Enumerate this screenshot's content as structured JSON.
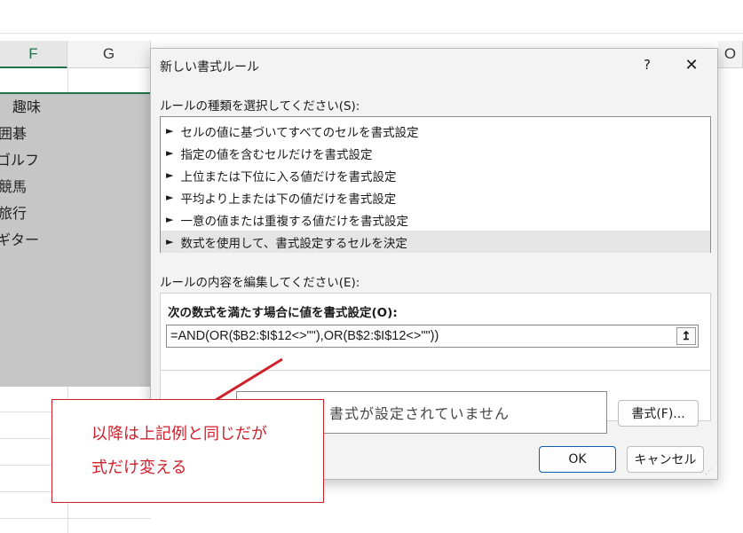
{
  "spreadsheet": {
    "columns": [
      "F",
      "G",
      "O"
    ],
    "header_cell": "趣味",
    "rows": [
      "囲碁",
      "ゴルフ",
      "競馬",
      "旅行",
      "ギター"
    ]
  },
  "dialog": {
    "title": "新しい書式ルール",
    "help": "?",
    "close": "✕",
    "rule_type_label": "ルールの種類を選択してください(S):",
    "rule_types": [
      "セルの値に基づいてすべてのセルを書式設定",
      "指定の値を含むセルだけを書式設定",
      "上位または下位に入る値だけを書式設定",
      "平均より上または下の値だけを書式設定",
      "一意の値または重複する値だけを書式設定",
      "数式を使用して、書式設定するセルを決定"
    ],
    "selected_rule_index": 5,
    "edit_label": "ルールの内容を編集してください(E):",
    "formula_label": "次の数式を満たす場合に値を書式設定(O):",
    "formula_value": "=AND(OR($B2:$I$12<>\"\"),OR(B$2:$I$12<>\"\"))",
    "upload_icon": "↥",
    "preview_text": "書式が設定されていません",
    "format_button": "書式(F)...",
    "ok_button": "OK",
    "cancel_button": "キャンセル"
  },
  "annotation": {
    "line1": "以降は上記例と同じだが",
    "line2": "式だけ変える",
    "color": "#d0202c"
  }
}
